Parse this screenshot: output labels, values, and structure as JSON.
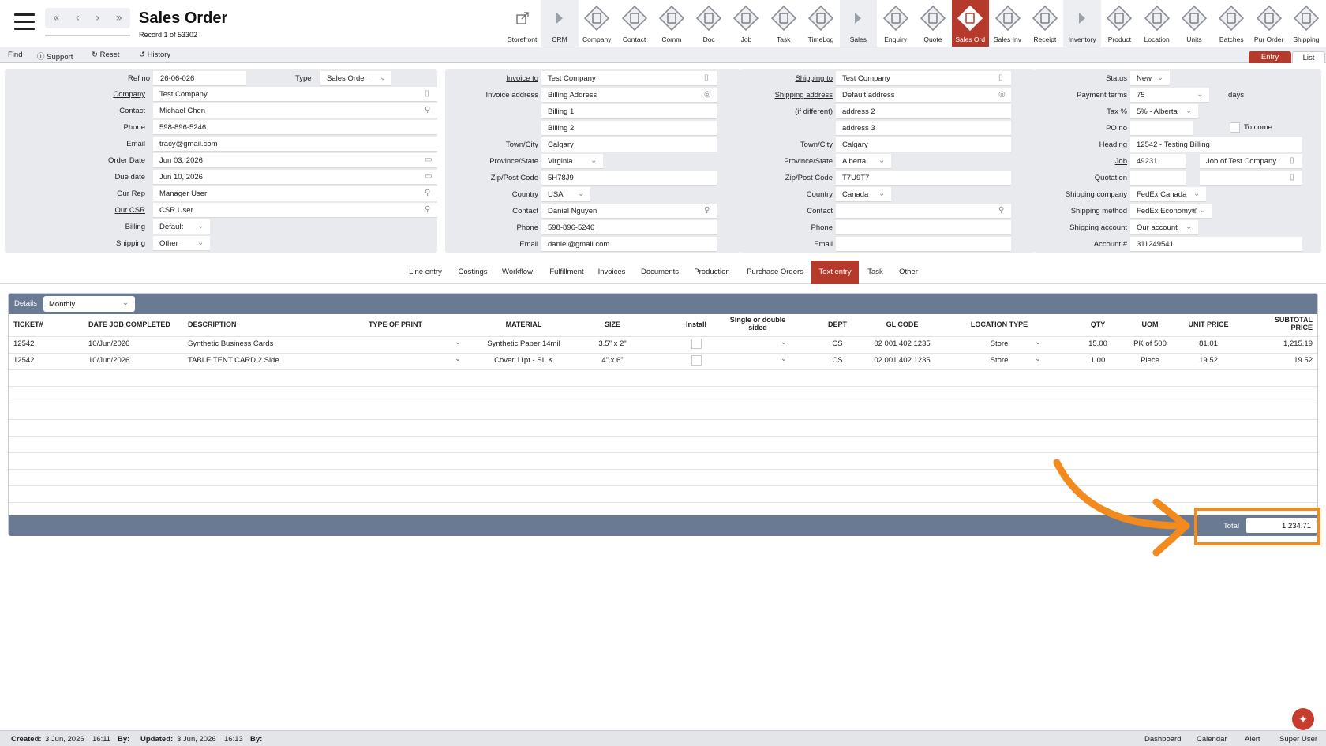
{
  "header": {
    "title": "Sales Order",
    "record": "Record 1 of 53302",
    "nav": [
      "«",
      "‹",
      "›",
      "»"
    ]
  },
  "modules": [
    {
      "label": "Storefront",
      "icon": "storefront-icon"
    },
    {
      "label": "CRM",
      "icon": "crm-arrow-icon"
    },
    {
      "label": "Company",
      "icon": "company-icon"
    },
    {
      "label": "Contact",
      "icon": "contact-icon"
    },
    {
      "label": "Comm",
      "icon": "comm-icon"
    },
    {
      "label": "Doc",
      "icon": "doc-icon"
    },
    {
      "label": "Job",
      "icon": "job-icon"
    },
    {
      "label": "Task",
      "icon": "task-icon"
    },
    {
      "label": "TimeLog",
      "icon": "timelog-icon"
    },
    {
      "label": "Sales",
      "icon": "sales-arrow-icon"
    },
    {
      "label": "Enquiry",
      "icon": "enquiry-icon"
    },
    {
      "label": "Quote",
      "icon": "quote-icon"
    },
    {
      "label": "Sales Ord",
      "icon": "sales-order-icon"
    },
    {
      "label": "Sales Inv",
      "icon": "sales-invoice-icon"
    },
    {
      "label": "Receipt",
      "icon": "receipt-icon"
    },
    {
      "label": "Inventory",
      "icon": "inventory-arrow-icon"
    },
    {
      "label": "Product",
      "icon": "product-icon"
    },
    {
      "label": "Location",
      "icon": "location-icon"
    },
    {
      "label": "Units",
      "icon": "units-icon"
    },
    {
      "label": "Batches",
      "icon": "batches-icon"
    },
    {
      "label": "Pur Order",
      "icon": "purchase-order-icon"
    },
    {
      "label": "Shipping",
      "icon": "shipping-icon"
    }
  ],
  "toolbar": {
    "find": "Find",
    "support": "Support",
    "reset": "Reset",
    "history": "History",
    "entry": "Entry",
    "list": "List"
  },
  "order": {
    "ref_no_label": "Ref no",
    "ref_no": "26-06-026",
    "type_label": "Type",
    "type": "Sales Order",
    "company_label": "Company",
    "company": "Test Company",
    "contact_label": "Contact",
    "contact": "Michael Chen",
    "phone_label": "Phone",
    "phone": "598-896-5246",
    "email_label": "Email",
    "email": "tracy@gmail.com",
    "order_date_label": "Order Date",
    "order_date": "Jun 03, 2026",
    "due_date_label": "Due date",
    "due_date": "Jun 10, 2026",
    "our_rep_label": "Our Rep",
    "our_rep": "Manager User",
    "our_csr_label": "Our CSR",
    "our_csr": "CSR User",
    "billing_label": "Billing",
    "billing": "Default",
    "shipping_label": "Shipping",
    "shipping": "Other"
  },
  "invoice": {
    "to_label": "Invoice to",
    "to": "Test Company",
    "address_label": "Invoice address",
    "address": "Billing Address",
    "line1": "Billing 1",
    "line2": "Billing 2",
    "city_label": "Town/City",
    "city": "Calgary",
    "province_label": "Province/State",
    "province": "Virginia",
    "zip_label": "Zip/Post Code",
    "zip": "5H78J9",
    "country_label": "Country",
    "country": "USA",
    "contact_label": "Contact",
    "contact": "Daniel Nguyen",
    "phone_label": "Phone",
    "phone": "598-896-5246",
    "email_label": "Email",
    "email": "daniel@gmail.com"
  },
  "shipping": {
    "to_label": "Shipping to",
    "to": "Test Company",
    "address_label": "Shipping address",
    "address": "Default address",
    "diff_label": "(if different)",
    "line2": "address 2",
    "line3": "address 3",
    "city_label": "Town/City",
    "city": "Calgary",
    "province_label": "Province/State",
    "province": "Alberta",
    "zip_label": "Zip/Post Code",
    "zip": "T7U9T7",
    "country_label": "Country",
    "country": "Canada",
    "contact_label": "Contact",
    "contact": "",
    "phone_label": "Phone",
    "phone": "",
    "email_label": "Email",
    "email": ""
  },
  "status": {
    "status_label": "Status",
    "status": "New",
    "terms_label": "Payment terms",
    "terms": "75",
    "terms_unit": "days",
    "tax_label": "Tax %",
    "tax": "5% - Alberta",
    "po_label": "PO no",
    "po": "",
    "to_come": "To come",
    "heading_label": "Heading",
    "heading": "12542 - Testing Billing",
    "job_label": "Job",
    "job": "49231",
    "job_desc": "Job of Test Company",
    "quotation_label": "Quotation",
    "quotation": "",
    "ship_company_label": "Shipping company",
    "ship_company": "FedEx Canada",
    "ship_method_label": "Shipping method",
    "ship_method": "FedEx Economy®",
    "ship_account_label": "Shipping account",
    "ship_account": "Our account",
    "account_label": "Account #",
    "account": "311249541"
  },
  "tabs": [
    "Line entry",
    "Costings",
    "Workflow",
    "Fulfillment",
    "Invoices",
    "Documents",
    "Production",
    "Purchase Orders",
    "Text entry",
    "Task",
    "Other"
  ],
  "grid": {
    "details_label": "Details",
    "period": "Monthly",
    "columns": [
      "TICKET#",
      "DATE JOB COMPLETED",
      "DESCRIPTION",
      "TYPE OF PRINT",
      "MATERIAL",
      "SIZE",
      "Install",
      "Single or double sided",
      "DEPT",
      "GL CODE",
      "LOCATION TYPE",
      "QTY",
      "UOM",
      "UNIT PRICE",
      "SUBTOTAL PRICE"
    ],
    "rows": [
      {
        "ticket": "12542",
        "date": "10/Jun/2026",
        "description": "Synthetic Business Cards",
        "type_of_print": "",
        "material": "Synthetic Paper 14mil",
        "size": "3.5\" x 2\"",
        "sided": "",
        "dept": "CS",
        "gl_code": "02 001 402 1235",
        "location_type": "Store",
        "qty": "15.00",
        "uom": "PK of 500",
        "unit_price": "81.01",
        "subtotal": "1,215.19"
      },
      {
        "ticket": "12542",
        "date": "10/Jun/2026",
        "description": "TABLE TENT CARD 2 Side",
        "type_of_print": "",
        "material": "Cover 11pt - SILK",
        "size": "4\" x 6\"",
        "sided": "",
        "dept": "CS",
        "gl_code": "02 001 402 1235",
        "location_type": "Store",
        "qty": "1.00",
        "uom": "Piece",
        "unit_price": "19.52",
        "subtotal": "19.52"
      }
    ],
    "total_label": "Total",
    "total": "1,234.71"
  },
  "footer": {
    "created_label": "Created:",
    "created": "3 Jun, 2026",
    "created_time": "16:11",
    "by1": "By:",
    "updated_label": "Updated:",
    "updated": "3 Jun, 2026",
    "updated_time": "16:13",
    "by2": "By:",
    "links": [
      "Dashboard",
      "Calendar",
      "Alert",
      "Super User"
    ]
  },
  "colors": {
    "accent": "#b53a2c",
    "grid_header": "#6b7a93",
    "highlight": "#f28a1e"
  }
}
